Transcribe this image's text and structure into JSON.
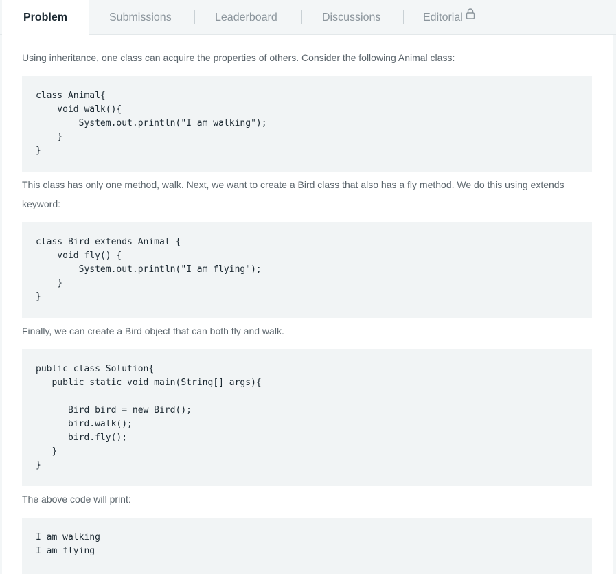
{
  "tabs": {
    "problem": "Problem",
    "submissions": "Submissions",
    "leaderboard": "Leaderboard",
    "discussions": "Discussions",
    "editorial": "Editorial"
  },
  "content": {
    "intro": "Using inheritance, one class can acquire the properties of others. Consider the following Animal class:",
    "code_animal": "class Animal{\n    void walk(){\n        System.out.println(\"I am walking\");\n    }\n}",
    "para_bird": "This class has only one method, walk. Next, we want to create a Bird class that also has a fly method. We do this using extends keyword:",
    "code_bird": "class Bird extends Animal {\n    void fly() {\n        System.out.println(\"I am flying\");\n    }\n}",
    "para_finally": "Finally, we can create a Bird object that can both fly and walk.",
    "code_solution": "public class Solution{\n   public static void main(String[] args){\n\n      Bird bird = new Bird();\n      bird.walk();\n      bird.fly();\n   }\n}",
    "para_print": "The above code will print:",
    "code_output": "I am walking\nI am flying"
  },
  "icons": {
    "editorial_lock": "lock-icon"
  }
}
